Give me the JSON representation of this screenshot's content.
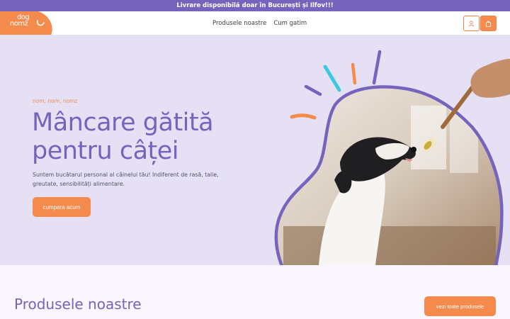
{
  "announcement": {
    "text": "Livrare disponibilă doar în București și Ilfov!!!"
  },
  "header": {
    "logo_line1": "dog",
    "logo_line2": "nomz",
    "nav": [
      {
        "label": "Produsele noastre"
      },
      {
        "label": "Cum gatim"
      }
    ],
    "icons": {
      "account": "user-icon",
      "cart": "shopping-bag-icon"
    }
  },
  "hero": {
    "tagline": "nom, nom, nomz",
    "headline_line1": "Mâncare gătită",
    "headline_line2": "pentru câței",
    "subtitle": "Suntem bucătarul personal al câinelui tău! Indiferent de rasă, talie, greutate, sensibilități alimentare.",
    "cta_label": "cumpara acum"
  },
  "products": {
    "title": "Produsele noastre",
    "see_all_label": "vezi toate produsele"
  },
  "colors": {
    "primary": "#7563bd",
    "accent": "#f58a4d",
    "hero_bg": "#e6e0f4",
    "teal": "#3ec8dc"
  }
}
